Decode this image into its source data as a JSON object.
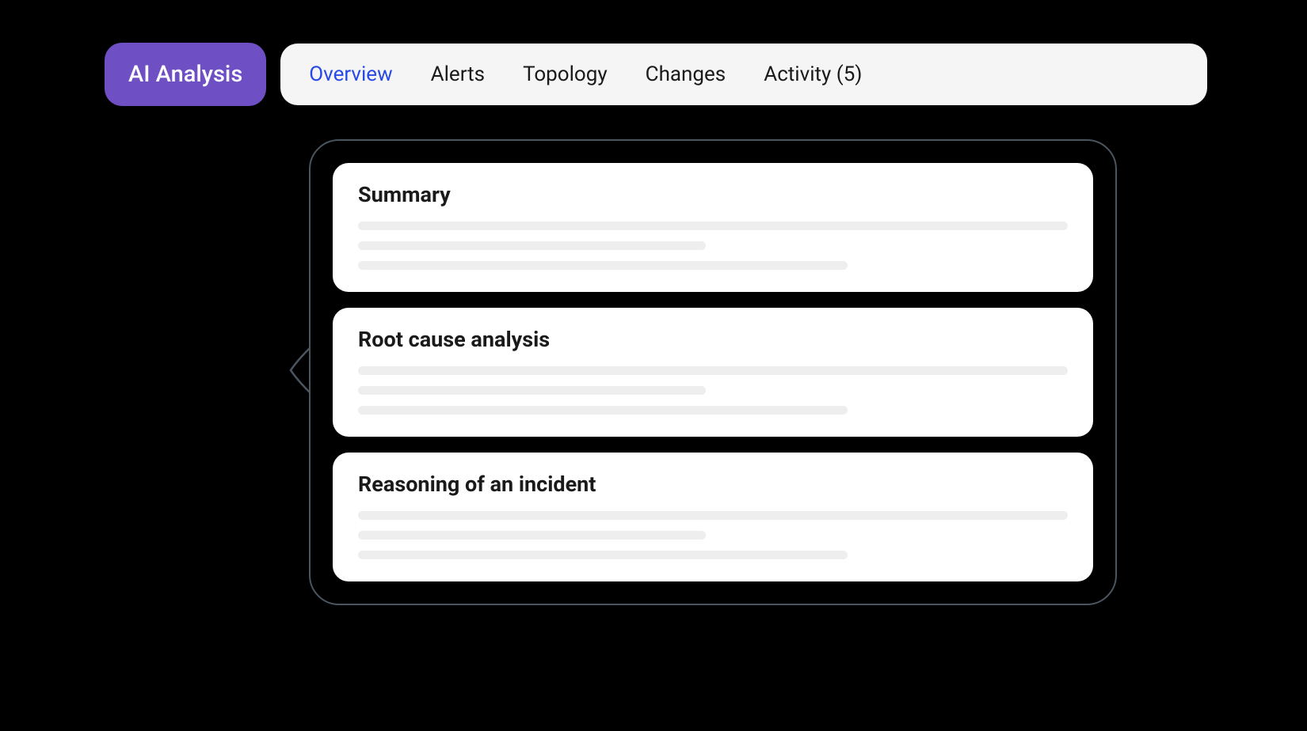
{
  "header": {
    "aiAnalysisLabel": "AI Analysis",
    "tabs": [
      {
        "label": "Overview",
        "active": true
      },
      {
        "label": "Alerts",
        "active": false
      },
      {
        "label": "Topology",
        "active": false
      },
      {
        "label": "Changes",
        "active": false
      },
      {
        "label": "Activity (5)",
        "active": false
      }
    ]
  },
  "cards": [
    {
      "title": "Summary"
    },
    {
      "title": "Root cause analysis"
    },
    {
      "title": "Reasoning of an incident"
    }
  ],
  "colors": {
    "brand": "#6F50C4",
    "activeTab": "#2949E5",
    "bubbleBorder": "#4a5560",
    "skeleton": "#EEEEEE",
    "tabsBg": "#F5F5F5"
  }
}
